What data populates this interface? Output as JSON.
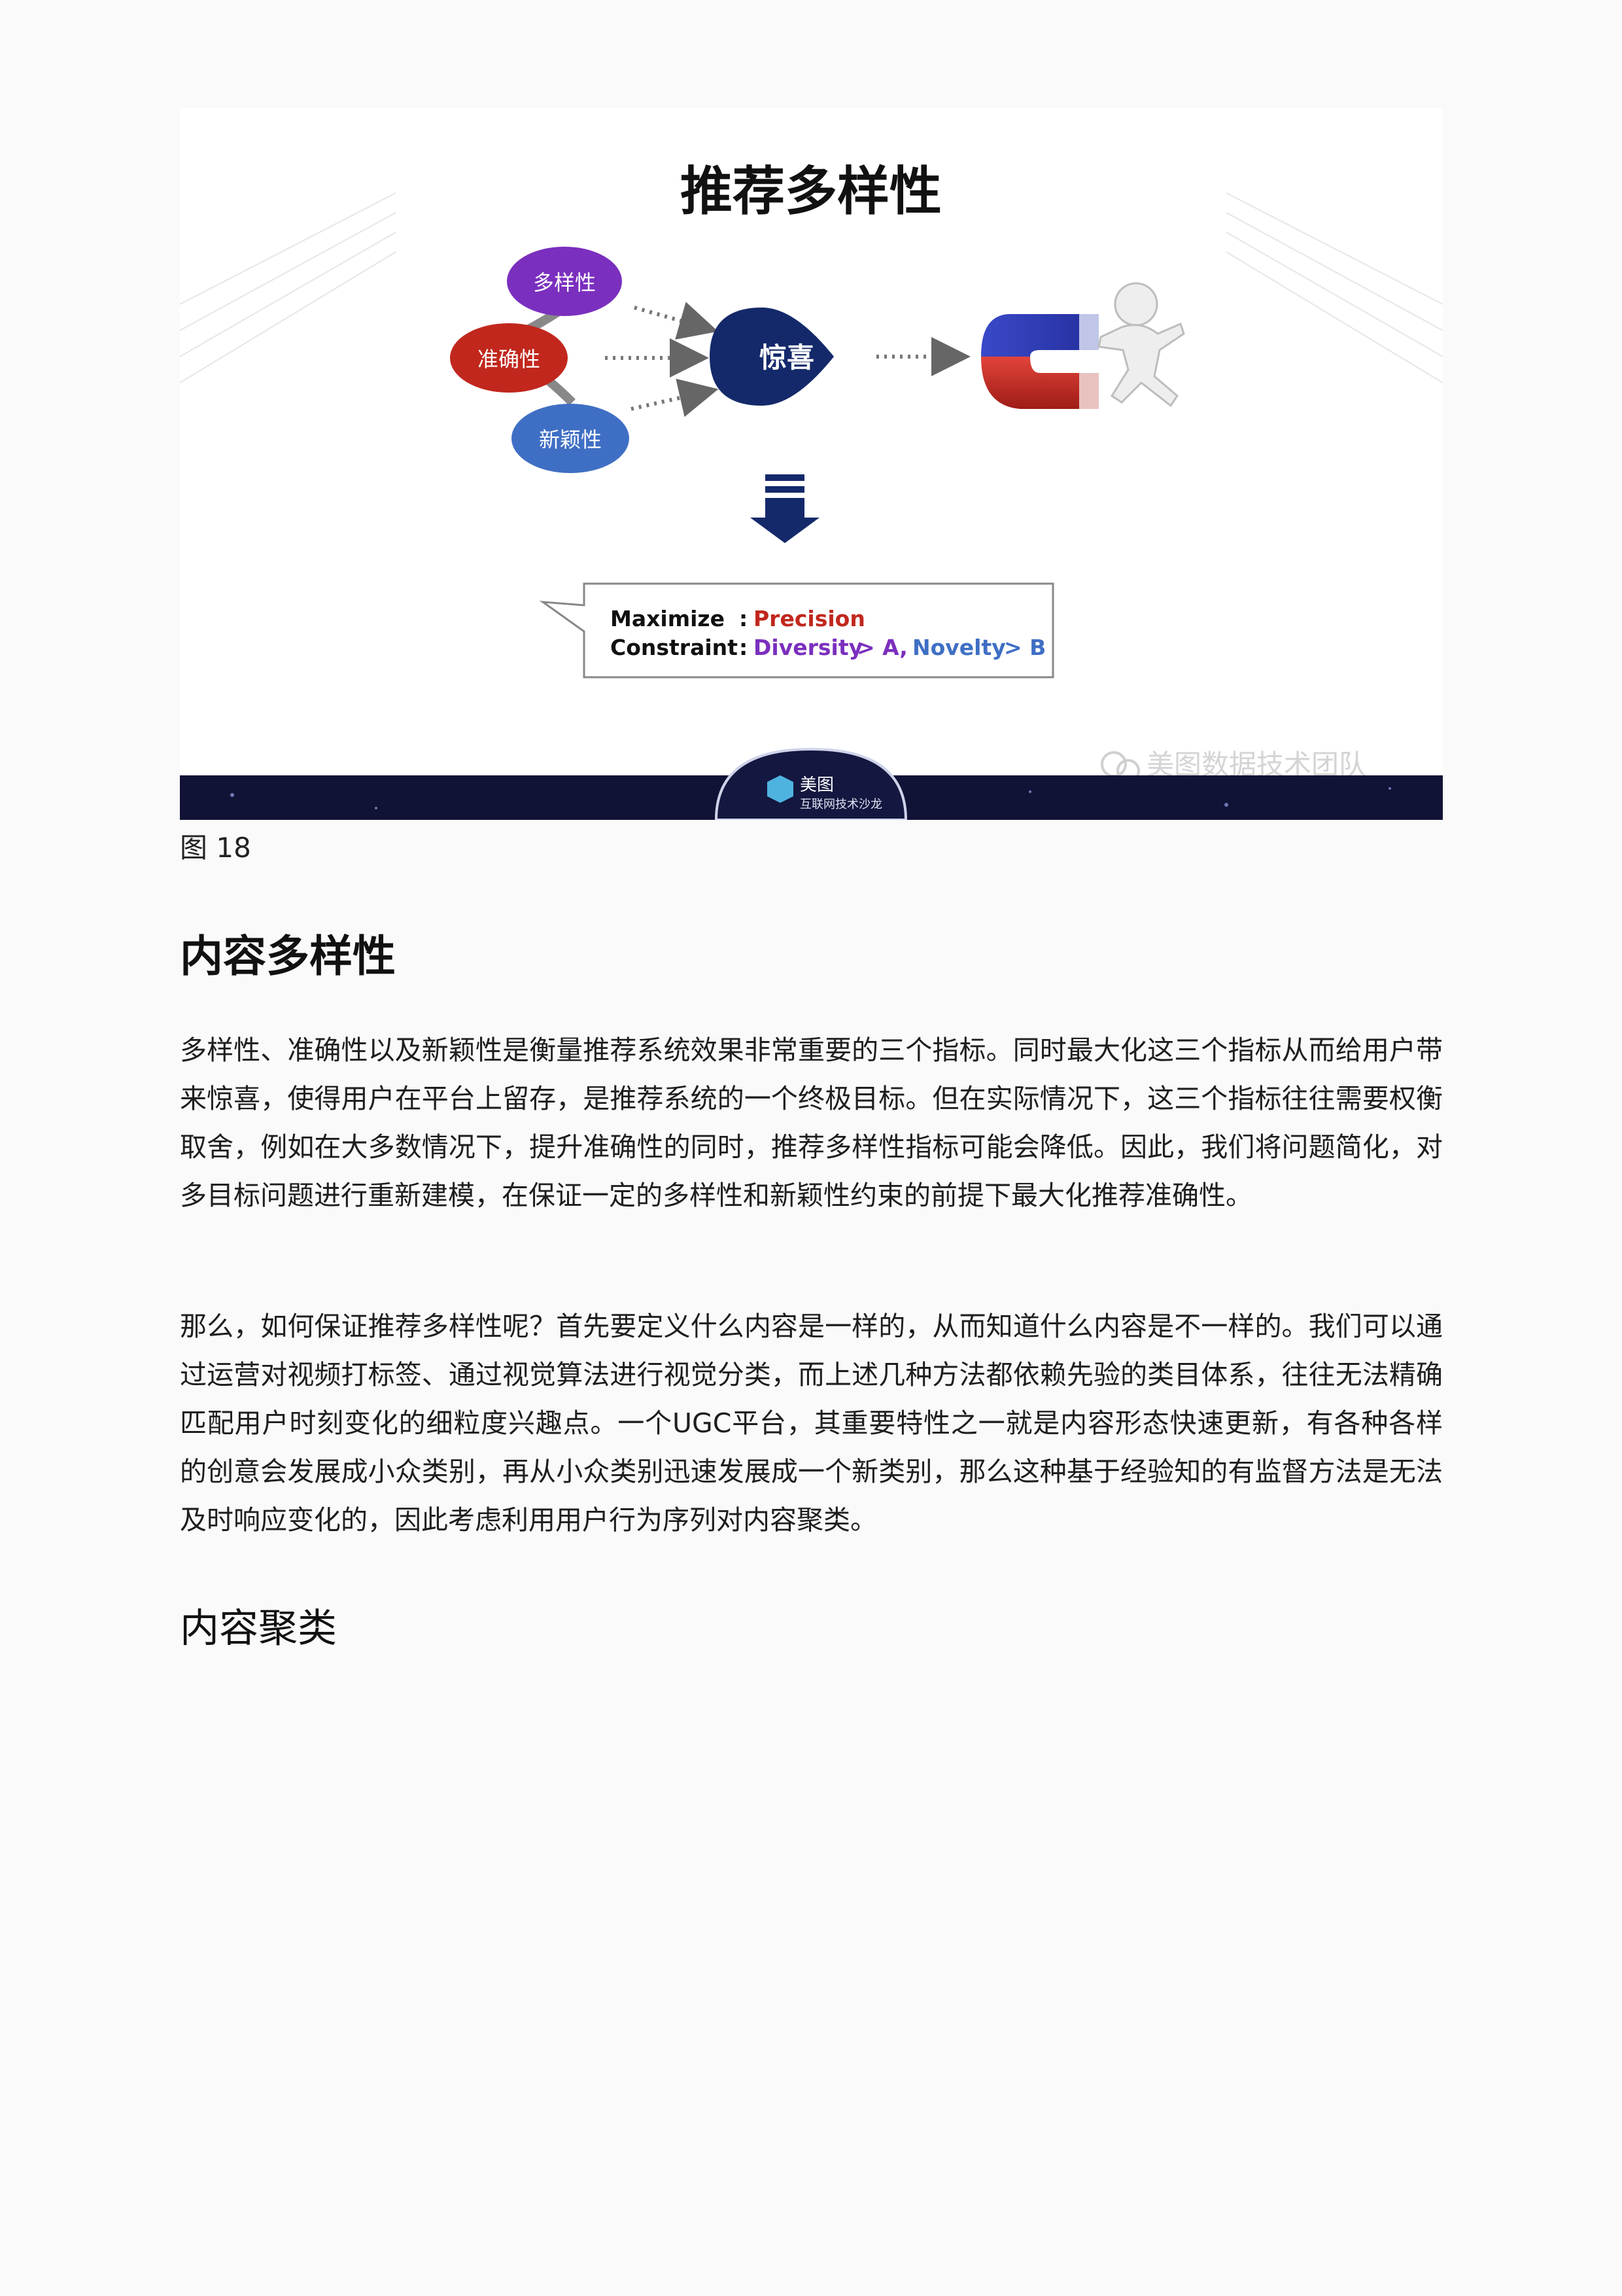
{
  "slide": {
    "title": "推荐多样性",
    "bubbles": {
      "diversity": "多样性",
      "accuracy": "准确性",
      "novelty": "新颖性",
      "surprise": "惊喜"
    },
    "formula": {
      "maximize_label": "Maximize",
      "colon": ":",
      "precision": "Precision",
      "constraint_label": "Constraint",
      "diversity": "Diversity",
      "gt_a": "> A,",
      "novelty": "Novelty",
      "gt_b": "> B"
    },
    "watermark": "美图数据技术团队",
    "badge_line1": "美图",
    "badge_line2": "互联网技术沙龙",
    "colors": {
      "purple": "#7b2fbe",
      "red": "#c1271d",
      "blue": "#3f6fc4",
      "navy": "#14296a",
      "footer": "#101236"
    }
  },
  "caption": "图 18",
  "section_title": "内容多样性",
  "paragraphs": [
    "多样性、准确性以及新颖性是衡量推荐系统效果非常重要的三个指标。同时最大化这三个指标从而给用户带来惊喜，使得用户在平台上留存，是推荐系统的一个终极目标。但在实际情况下，这三个指标往往需要权衡取舍，例如在大多数情况下，提升准确性的同时，推荐多样性指标可能会降低。因此，我们将问题简化，对多目标问题进行重新建模，在保证一定的多样性和新颖性约束的前提下最大化推荐准确性。",
    "那么，如何保证推荐多样性呢？首先要定义什么内容是一样的，从而知道什么内容是不一样的。我们可以通过运营对视频打标签、通过视觉算法进行视觉分类，而上述几种方法都依赖先验的类目体系，往往无法精确匹配用户时刻变化的细粒度兴趣点。一个UGC平台，其重要特性之一就是内容形态快速更新，有各种各样的创意会发展成小众类别，再从小众类别迅速发展成一个新类别，那么这种基于经验知的有监督方法是无法及时响应变化的，因此考虑利用用户行为序列对内容聚类。"
  ],
  "subsection_title": "内容聚类"
}
